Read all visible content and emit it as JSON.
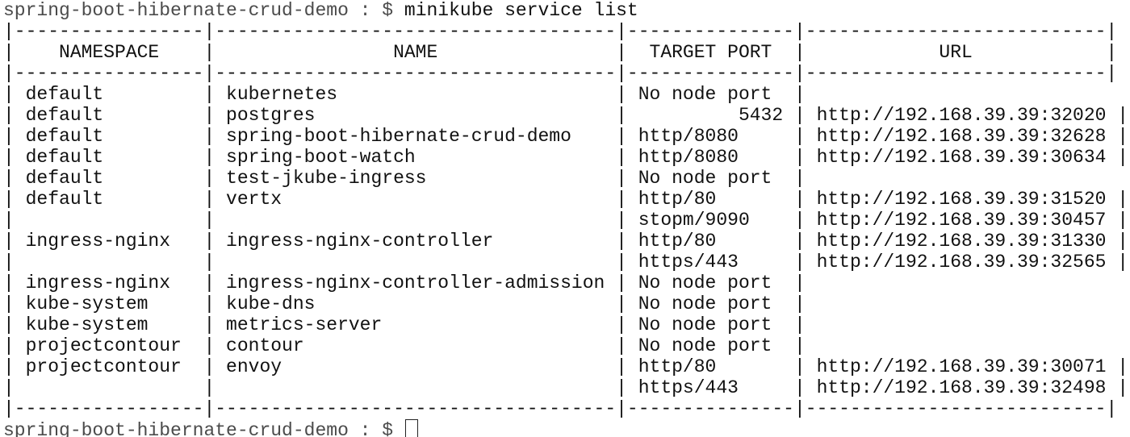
{
  "terminal": {
    "prompt": "spring-boot-hibernate-crud-demo : $ ",
    "command": "minikube service list",
    "table_lines": [
      "|-----------------|------------------------------------|---------------|---------------------------|",
      "|    NAMESPACE    |                NAME                |  TARGET PORT  |            URL            |",
      "|-----------------|------------------------------------|---------------|---------------------------|",
      "| default         | kubernetes                         | No node port  |",
      "| default         | postgres                           |          5432 | http://192.168.39.39:32020 |",
      "| default         | spring-boot-hibernate-crud-demo    | http/8080     | http://192.168.39.39:32628 |",
      "| default         | spring-boot-watch                  | http/8080     | http://192.168.39.39:30634 |",
      "| default         | test-jkube-ingress                 | No node port  |",
      "| default         | vertx                              | http/80       | http://192.168.39.39:31520 |",
      "|                 |                                    | stopm/9090    | http://192.168.39.39:30457 |",
      "| ingress-nginx   | ingress-nginx-controller           | http/80       | http://192.168.39.39:31330 |",
      "|                 |                                    | https/443     | http://192.168.39.39:32565 |",
      "| ingress-nginx   | ingress-nginx-controller-admission | No node port  |",
      "| kube-system     | kube-dns                           | No node port  |",
      "| kube-system     | metrics-server                     | No node port  |",
      "| projectcontour  | contour                            | No node port  |",
      "| projectcontour  | envoy                              | http/80       | http://192.168.39.39:30071 |",
      "|                 |                                    | https/443     | http://192.168.39.39:32498 |",
      "|-----------------|------------------------------------|---------------|---------------------------|"
    ],
    "final_prompt": "spring-boot-hibernate-crud-demo : $ "
  }
}
